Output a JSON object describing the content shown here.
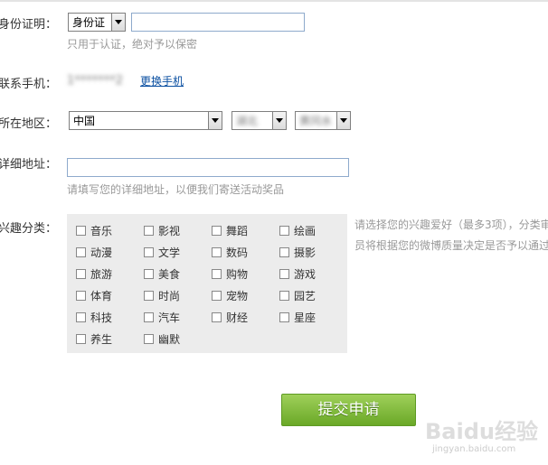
{
  "id_row": {
    "label": "身份证明：",
    "id_type": "身份证",
    "id_value": "",
    "hint": "只用于认证，绝对予以保密"
  },
  "phone_row": {
    "label": "联系手机：",
    "masked_number": "1*******2",
    "change_link": "更换手机"
  },
  "region_row": {
    "label": "所在地区：",
    "country": "中国",
    "province": "湖北",
    "city": "黄冈水"
  },
  "address_row": {
    "label": "详细地址：",
    "value": "",
    "hint": "请填写您的详细地址，以便我们寄送活动奖品"
  },
  "interests": {
    "label": "兴趣分类：",
    "side_note_line1": "请选择您的兴趣爱好（最多3项），分类审",
    "side_note_line2": "员将根据您的微博质量决定是否予以通过",
    "options": [
      "音乐",
      "影视",
      "舞蹈",
      "绘画",
      "动漫",
      "文学",
      "数码",
      "摄影",
      "旅游",
      "美食",
      "购物",
      "游戏",
      "体育",
      "时尚",
      "宠物",
      "园艺",
      "科技",
      "汽车",
      "财经",
      "星座",
      "养生",
      "幽默"
    ]
  },
  "submit": {
    "label": "提交申请"
  },
  "watermark": {
    "brand": "Baidu经验",
    "url": "jingyan.baidu.com"
  }
}
